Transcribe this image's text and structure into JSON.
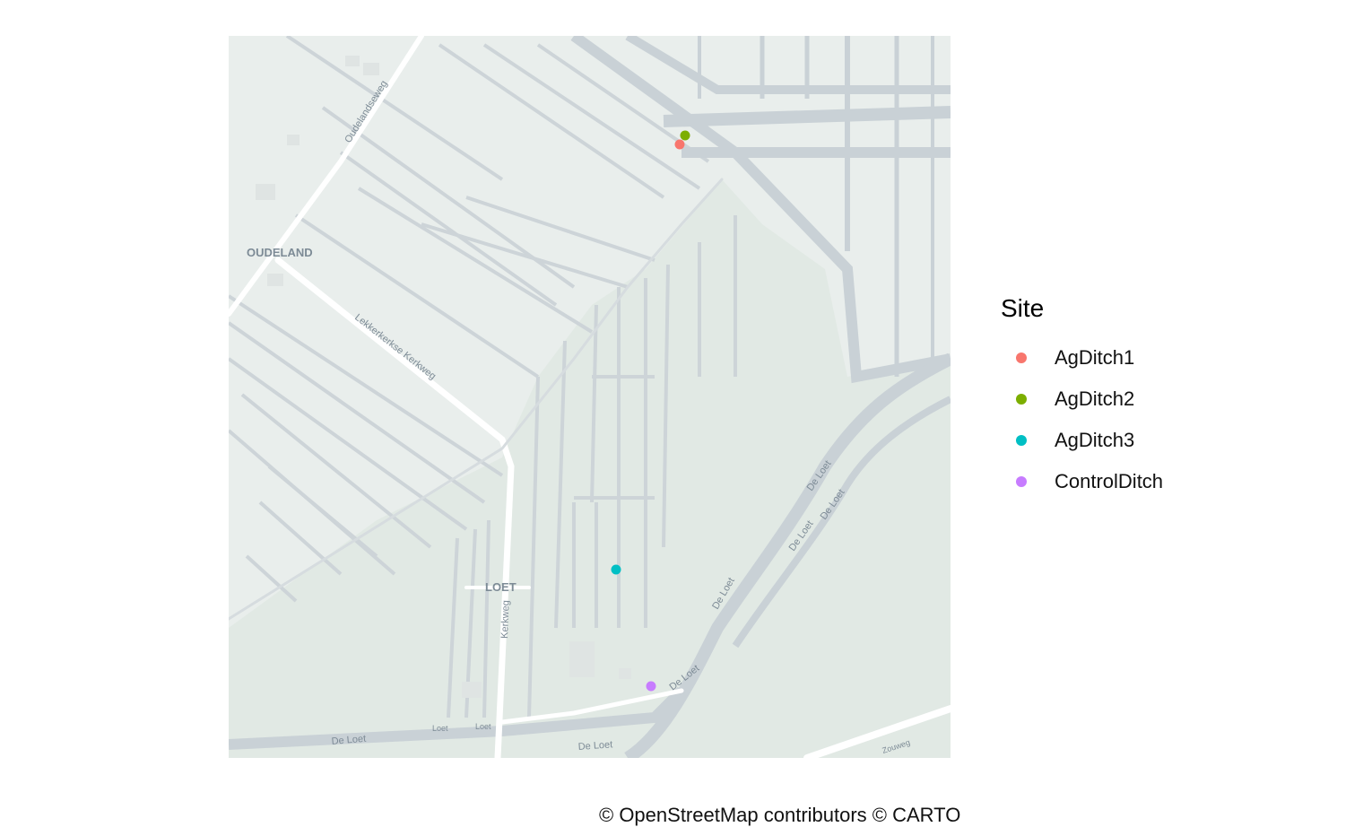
{
  "map": {
    "basemap": "CARTO Positron (OpenStreetMap)",
    "place_labels": [
      "OUDELAND",
      "LOET"
    ],
    "road_labels": [
      "Oudelandseweg",
      "Lekkerkerkse Kerkweg",
      "Kerkweg",
      "De Loet",
      "De Loet",
      "De Loet",
      "De Loet",
      "De Loet",
      "De Loet",
      "De Loet",
      "Loet",
      "Loet",
      "Zouweg"
    ],
    "colors": {
      "land": "#e9eeec",
      "wetland": "#e1e9e4",
      "water": "#c9d1d6",
      "road": "#ffffff",
      "label": "#7d8b96"
    }
  },
  "sites": [
    {
      "name": "AgDitch1",
      "color": "#F8766D"
    },
    {
      "name": "AgDitch2",
      "color": "#7CAE00"
    },
    {
      "name": "AgDitch3",
      "color": "#00BFC4"
    },
    {
      "name": "ControlDitch",
      "color": "#C77CFF"
    }
  ],
  "legend": {
    "title": "Site",
    "items": [
      "AgDitch1",
      "AgDitch2",
      "AgDitch3",
      "ControlDitch"
    ]
  },
  "caption": "© OpenStreetMap contributors © CARTO"
}
